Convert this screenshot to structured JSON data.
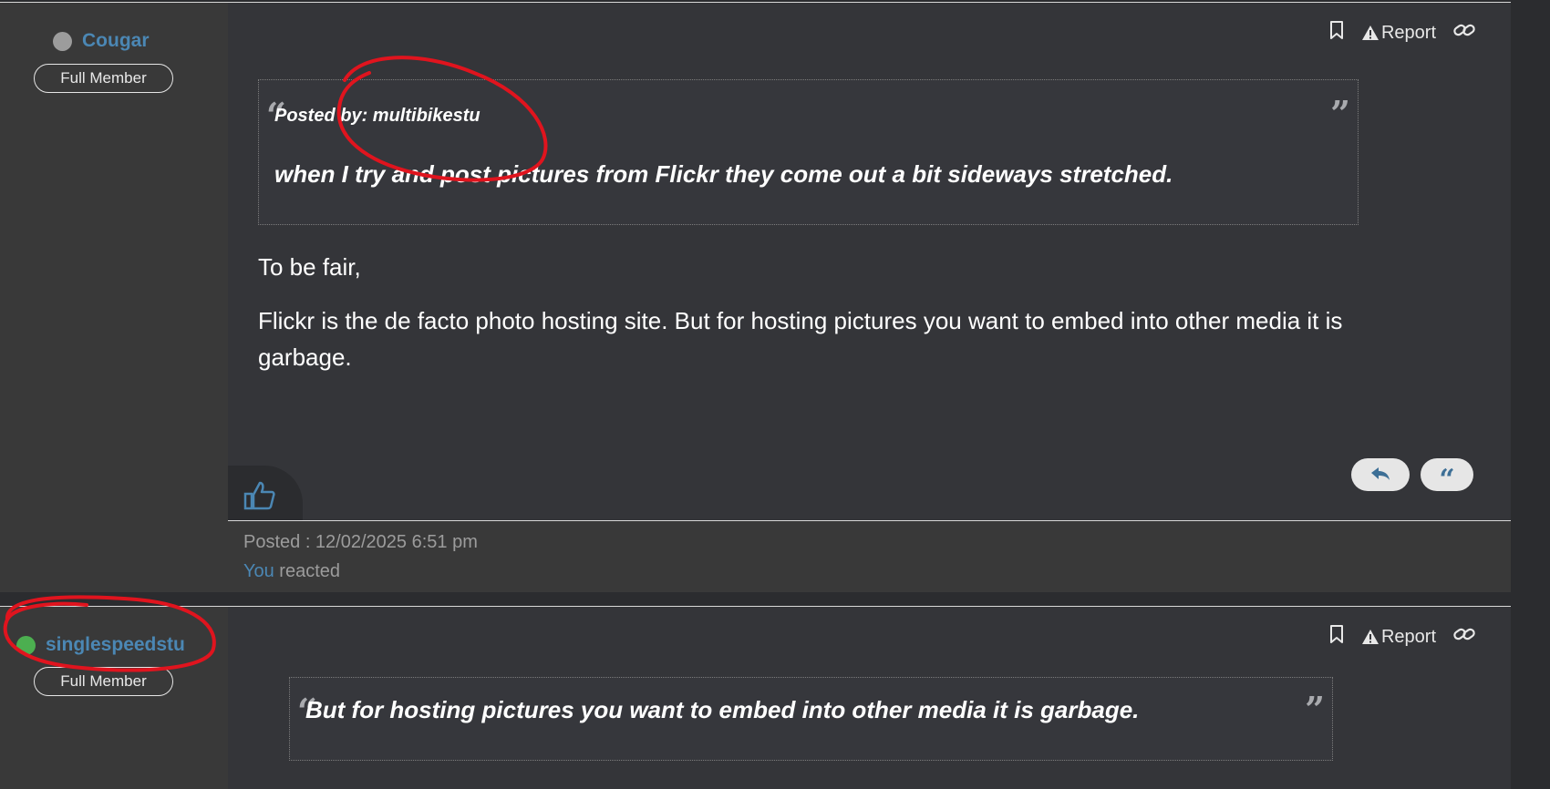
{
  "posts": [
    {
      "author": "Cougar",
      "status_color": "#9c9c9c",
      "rank": "Full Member",
      "actions": {
        "report": "Report"
      },
      "quote": {
        "attribution": "Posted by: multibikestu",
        "text": "when I try and post pictures from Flickr they come out a bit sideways stretched."
      },
      "body": [
        "To be fair,",
        "Flickr is the de facto photo hosting site.  But for hosting pictures you want to embed into other media it is",
        "garbage."
      ],
      "posted": "Posted : 12/02/2025 6:51 pm",
      "reaction_you": "You",
      "reaction_text": " reacted"
    },
    {
      "author": "singlespeedstu",
      "status_color": "#4caf50",
      "rank": "Full Member",
      "actions": {
        "report": "Report"
      },
      "quote": {
        "text": "But for hosting pictures you want to embed into other media it is garbage."
      }
    }
  ],
  "colors": {
    "accent": "#4b87b4",
    "annotation": "#e0141e"
  }
}
